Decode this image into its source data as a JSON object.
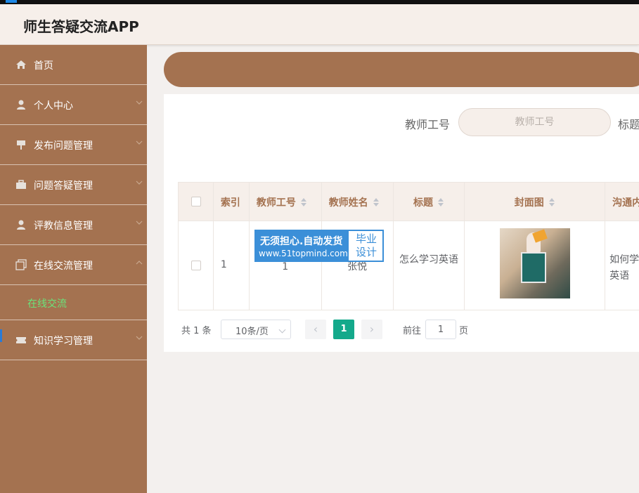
{
  "app": {
    "title": "师生答疑交流APP"
  },
  "sidebar": {
    "items": [
      {
        "label": "首页",
        "icon": "home-icon"
      },
      {
        "label": "个人中心",
        "icon": "user-icon"
      },
      {
        "label": "发布问题管理",
        "icon": "sign-icon"
      },
      {
        "label": "问题答疑管理",
        "icon": "briefcase-icon"
      },
      {
        "label": "评教信息管理",
        "icon": "user-icon"
      },
      {
        "label": "在线交流管理",
        "icon": "copy-icon"
      },
      {
        "label": "知识学习管理",
        "icon": "ticket-icon"
      }
    ],
    "submenu": {
      "label": "在线交流"
    }
  },
  "search": {
    "teacher_id_label": "教师工号",
    "teacher_id_placeholder": "教师工号",
    "title_label": "标题"
  },
  "table": {
    "headers": [
      "索引",
      "教师工号",
      "教师姓名",
      "标题",
      "封面图",
      "沟通内容"
    ],
    "rows": [
      {
        "index": "1",
        "teacher_id": "1",
        "teacher_name": "张悦",
        "title": "怎么学习英语",
        "content": "如何学习英语"
      }
    ]
  },
  "watermark": {
    "line1": "无须担心.自动发货",
    "line2": "www.51topmind.com",
    "right": "毕业设计"
  },
  "pagination": {
    "total": "共 1 条",
    "page_size": "10条/页",
    "current_page": "1",
    "goto_label": "前往",
    "goto_value": "1",
    "page_unit": "页"
  },
  "colors": {
    "accent": "#a47250",
    "header_bg": "#f6efea",
    "active_page": "#14a98b",
    "submenu_text": "#6be37a"
  }
}
